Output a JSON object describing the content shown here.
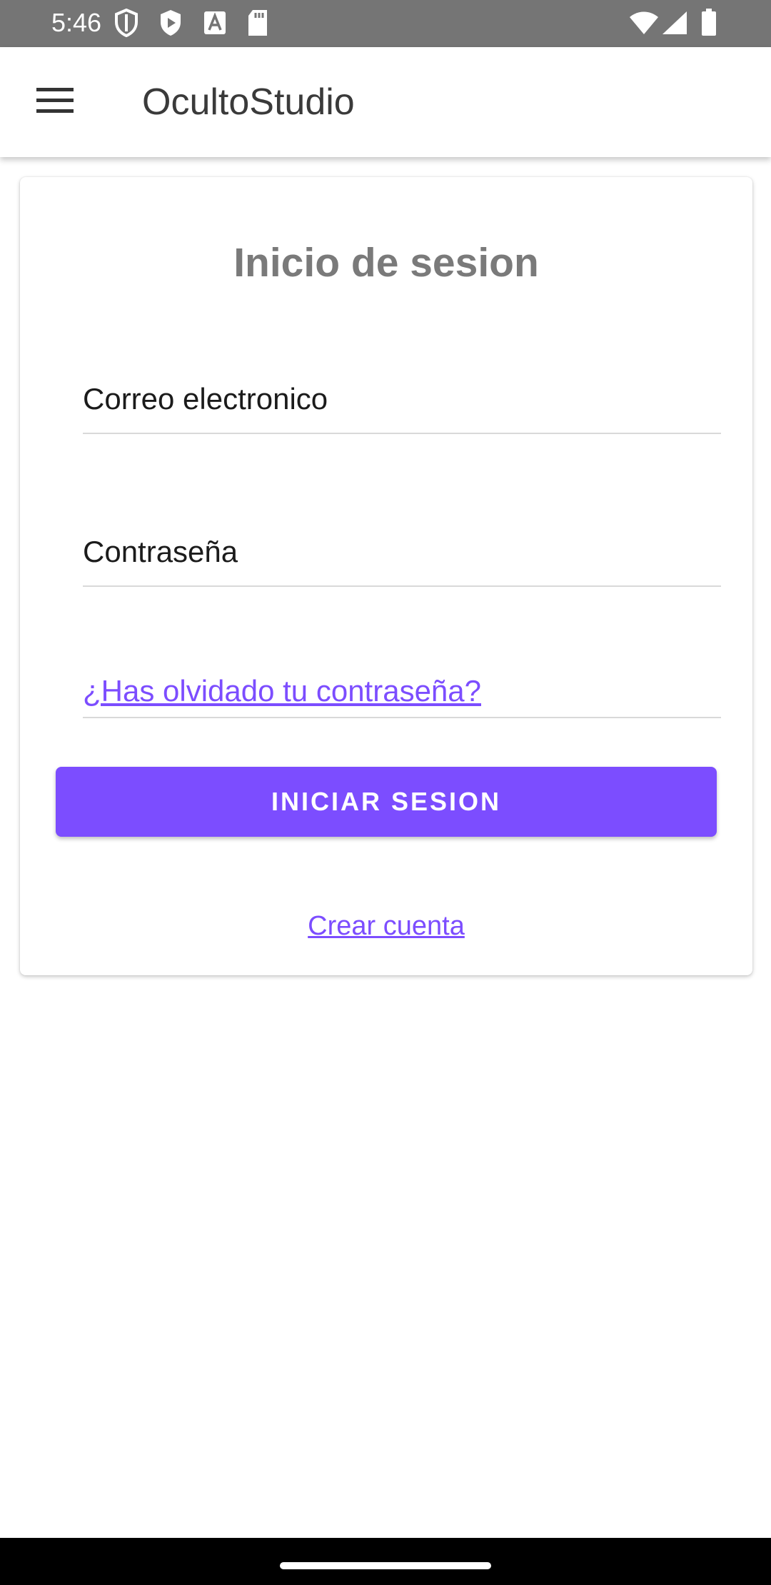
{
  "status_bar": {
    "time": "5:46",
    "left_icons": [
      "shield-outline-icon",
      "play-shield-icon",
      "font-a-icon",
      "sd-card-icon"
    ],
    "right_icons": [
      "wifi-icon",
      "cellular-signal-icon",
      "battery-icon"
    ]
  },
  "app_bar": {
    "title": "OcultoStudio",
    "menu_icon": "hamburger-menu-icon"
  },
  "login_card": {
    "title": "Inicio de sesion",
    "email_label": "Correo electronico",
    "password_label": "Contraseña",
    "forgot_password": "¿Has olvidado tu contraseña?",
    "login_button": "INICIAR SESION",
    "create_account": "Crear cuenta"
  },
  "colors": {
    "accent": "#7c4dff",
    "status_bar": "#757575",
    "title_gray": "#7a7a7a"
  }
}
